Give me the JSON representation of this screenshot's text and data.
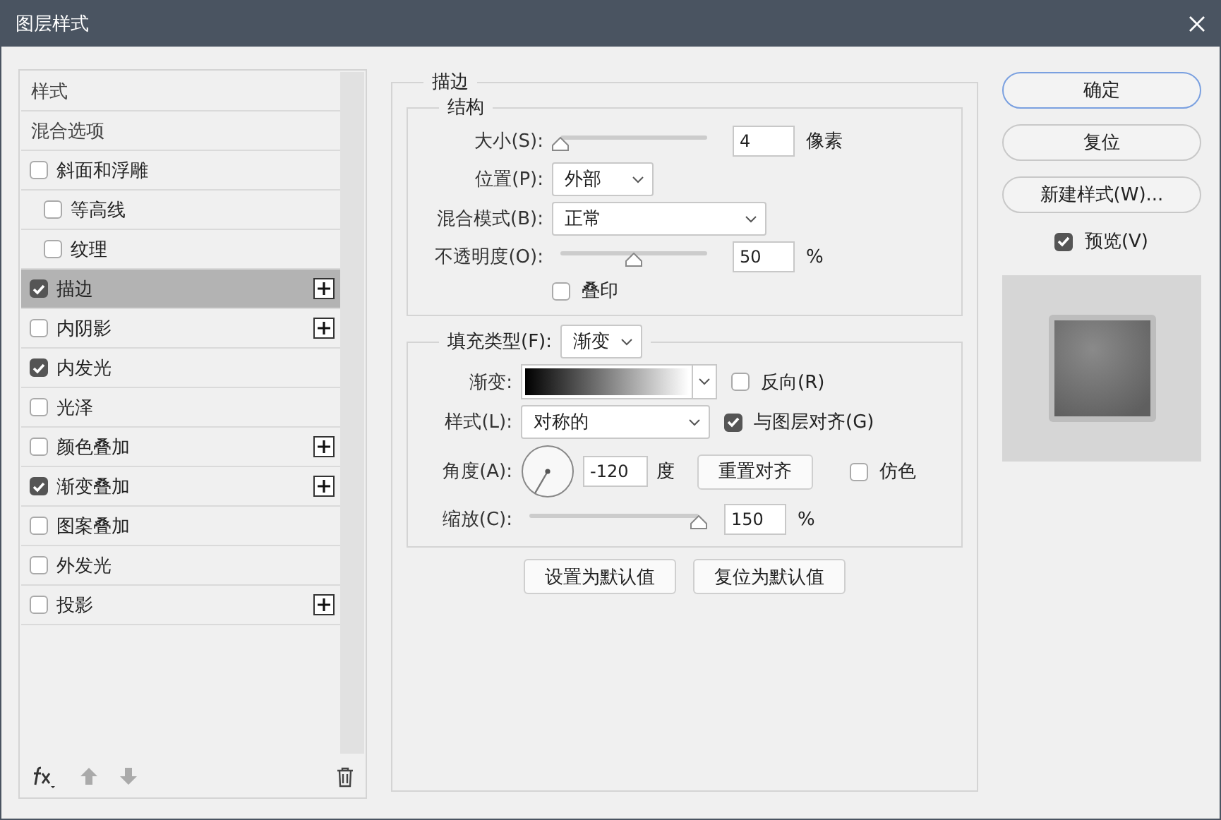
{
  "window": {
    "title": "图层样式"
  },
  "styles_panel": {
    "items": [
      {
        "kind": "header",
        "label": "样式",
        "selected": false
      },
      {
        "kind": "header",
        "label": "混合选项",
        "selected": false
      },
      {
        "kind": "effect",
        "label": "斜面和浮雕",
        "checked": false,
        "selected": false,
        "addable": false,
        "children": [
          {
            "kind": "effect",
            "label": "等高线",
            "checked": false,
            "selected": false,
            "addable": false
          },
          {
            "kind": "effect",
            "label": "纹理",
            "checked": false,
            "selected": false,
            "addable": false
          }
        ]
      },
      {
        "kind": "effect",
        "label": "描边",
        "checked": true,
        "selected": true,
        "addable": true
      },
      {
        "kind": "effect",
        "label": "内阴影",
        "checked": false,
        "selected": false,
        "addable": true
      },
      {
        "kind": "effect",
        "label": "内发光",
        "checked": true,
        "selected": false,
        "addable": false
      },
      {
        "kind": "effect",
        "label": "光泽",
        "checked": false,
        "selected": false,
        "addable": false
      },
      {
        "kind": "effect",
        "label": "颜色叠加",
        "checked": false,
        "selected": false,
        "addable": true
      },
      {
        "kind": "effect",
        "label": "渐变叠加",
        "checked": true,
        "selected": false,
        "addable": true
      },
      {
        "kind": "effect",
        "label": "图案叠加",
        "checked": false,
        "selected": false,
        "addable": false
      },
      {
        "kind": "effect",
        "label": "外发光",
        "checked": false,
        "selected": false,
        "addable": false
      },
      {
        "kind": "effect",
        "label": "投影",
        "checked": false,
        "selected": false,
        "addable": true
      }
    ]
  },
  "stroke": {
    "title": "描边",
    "structure": {
      "title": "结构",
      "size": {
        "label": "大小(S):",
        "level": 0,
        "value": "4",
        "unit": "像素"
      },
      "position": {
        "label": "位置(P):",
        "value": "外部"
      },
      "blend_mode": {
        "label": "混合模式(B):",
        "value": "正常"
      },
      "opacity": {
        "label": "不透明度(O):",
        "level": 0.5,
        "value": "50",
        "unit": "%"
      },
      "overprint": {
        "label": "叠印",
        "checked": false
      }
    },
    "fill": {
      "type_label": "填充类型(F):",
      "type_value": "渐变",
      "gradient": {
        "label": "渐变:",
        "reverse": {
          "label": "反向(R)",
          "checked": false
        }
      },
      "style": {
        "label": "样式(L):",
        "value": "对称的",
        "align": {
          "label": "与图层对齐(G)",
          "checked": true
        }
      },
      "angle": {
        "label": "角度(A):",
        "value": "-120",
        "unit": "度",
        "reset_button": "重置对齐",
        "dither": {
          "label": "仿色",
          "checked": false
        }
      },
      "scale": {
        "label": "缩放(C):",
        "level": 1,
        "value": "150",
        "unit": "%"
      }
    },
    "buttons": [
      "设置为默认值",
      "复位为默认值"
    ]
  },
  "actions": {
    "buttons": [
      {
        "label": "确定",
        "focused": true
      },
      {
        "label": "复位",
        "focused": false
      },
      {
        "label": "新建样式(W)...",
        "focused": false
      }
    ],
    "preview": {
      "label": "预览(V)",
      "checked": true
    }
  }
}
